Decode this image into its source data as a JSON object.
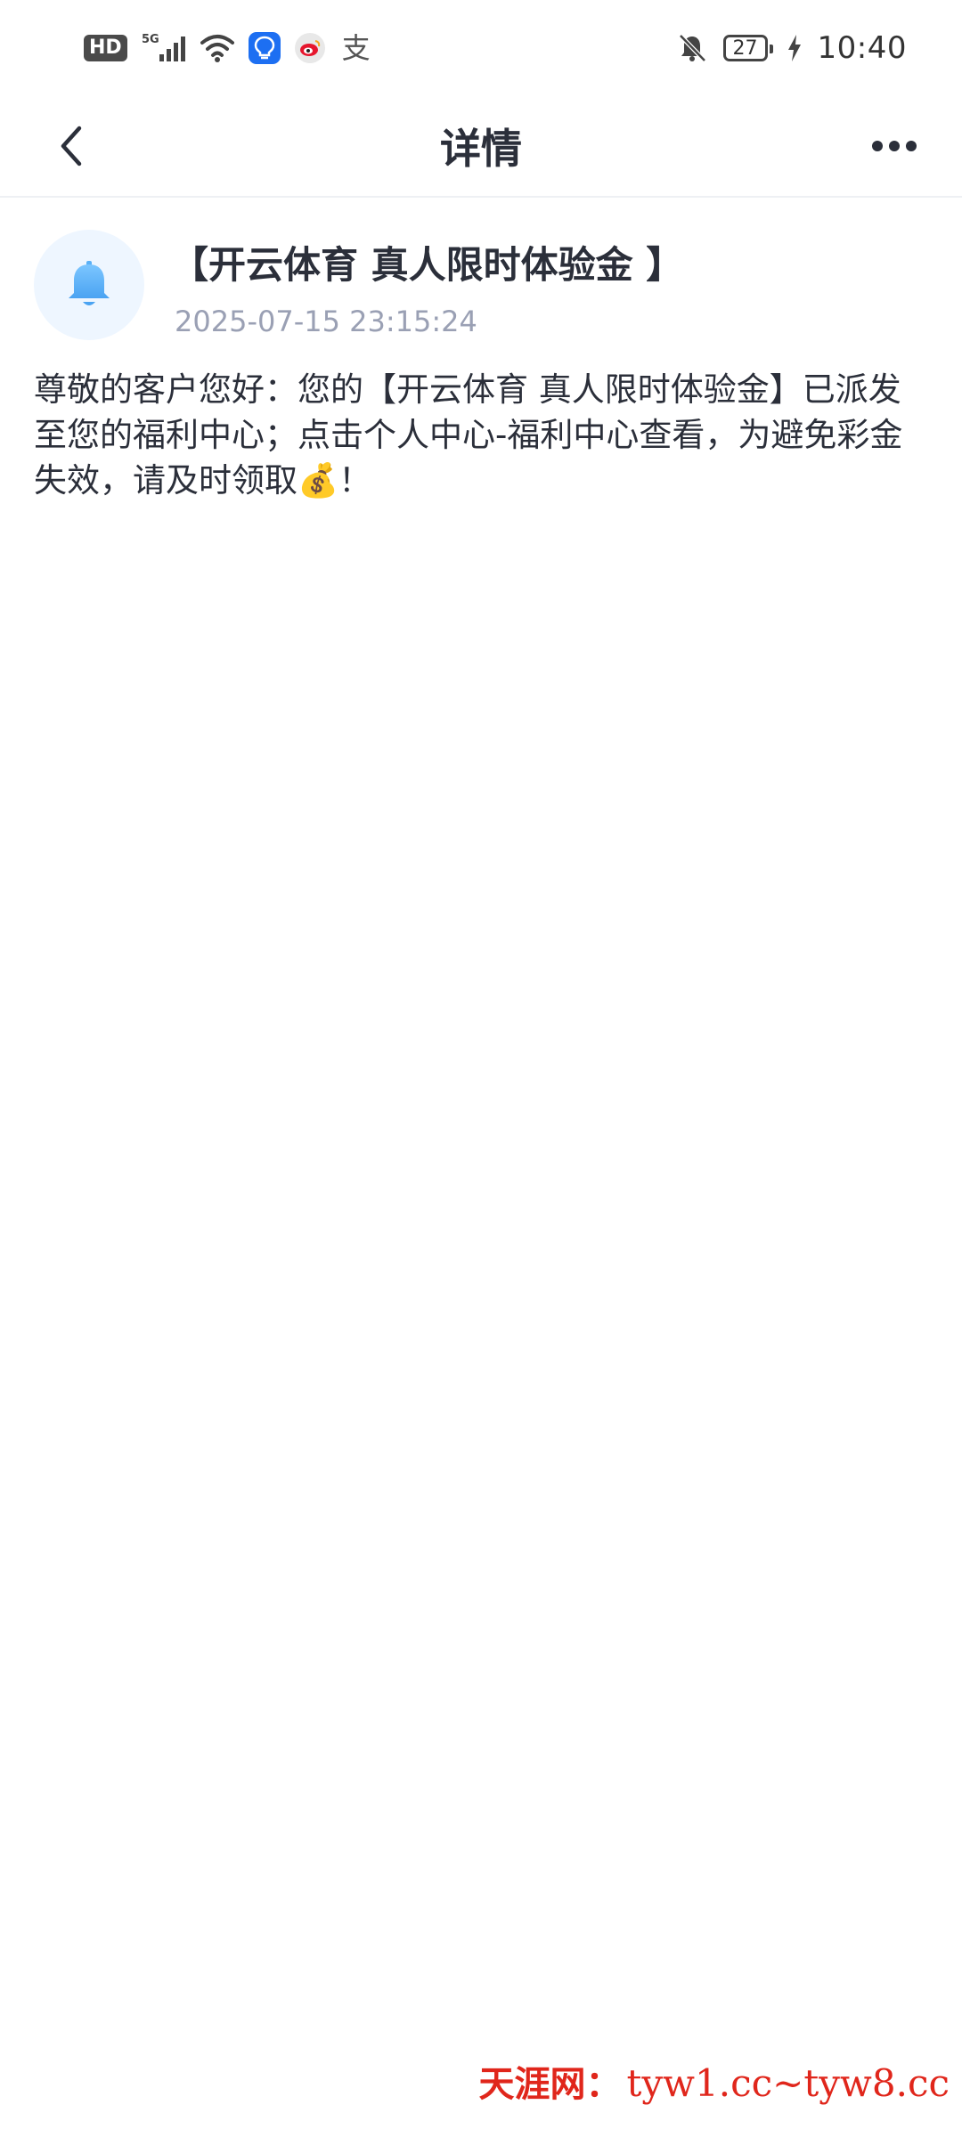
{
  "status_bar": {
    "hd_label": "HD",
    "network_label": "5G",
    "battery_level": "27",
    "time": "10:40",
    "icons": [
      "hd-icon",
      "signal-icon",
      "wifi-icon",
      "bulb-app-icon",
      "weibo-app-icon",
      "alipay-app-icon",
      "bell-muted-icon",
      "battery-icon",
      "charging-icon"
    ]
  },
  "header": {
    "title": "详情",
    "back_icon": "chevron-left-icon",
    "more_icon": "more-dots-icon"
  },
  "message": {
    "avatar_icon": "bell-icon",
    "title": "【开云体育 真人限时体验金 】",
    "time": "2025-07-15 23:15:24",
    "body": "尊敬的客户您好：您的【开云体育 真人限时体验金】已派发至您的福利中心；点击个人中心-福利中心查看，为避免彩金失效，请及时领取💰！"
  },
  "watermark": {
    "name": "天涯网：",
    "url": "tyw1.cc~tyw8.cc"
  },
  "colors": {
    "text_primary": "#2b2f3a",
    "text_secondary": "#9aa0b4",
    "bell_blue": "#5ab1f7",
    "avatar_bg": "#eef6ff",
    "watermark_red": "#e0261b"
  }
}
